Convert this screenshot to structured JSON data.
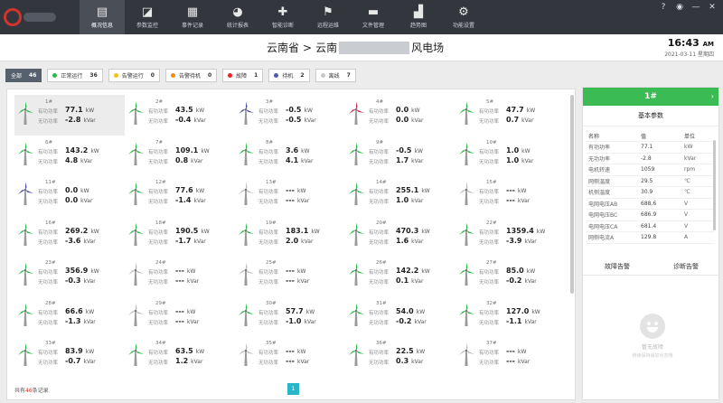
{
  "app": {
    "logo_icon": "company-logo-icon"
  },
  "nav": [
    {
      "label": "概况信息",
      "icon": "overview-icon",
      "glyph": "▤",
      "active": true
    },
    {
      "label": "参数监控",
      "icon": "monitor-icon",
      "glyph": "◪",
      "active": false
    },
    {
      "label": "事件记录",
      "icon": "event-log-icon",
      "glyph": "▦",
      "active": false
    },
    {
      "label": "统计报表",
      "icon": "pie-chart-icon",
      "glyph": "◕",
      "active": false
    },
    {
      "label": "智能诊断",
      "icon": "medical-kit-icon",
      "glyph": "✚",
      "active": false
    },
    {
      "label": "远程运维",
      "icon": "remote-maintenance-icon",
      "glyph": "⚑",
      "active": false
    },
    {
      "label": "文件管理",
      "icon": "folder-icon",
      "glyph": "▬",
      "active": false
    },
    {
      "label": "趋势图",
      "icon": "trend-chart-icon",
      "glyph": "▟",
      "active": false
    },
    {
      "label": "功能设置",
      "icon": "settings-icon",
      "glyph": "⚙",
      "active": false
    }
  ],
  "window_buttons": [
    {
      "glyph": "?",
      "icon": "help-icon"
    },
    {
      "glyph": "◉",
      "icon": "user-icon"
    },
    {
      "glyph": "—",
      "icon": "minimize-icon"
    },
    {
      "glyph": "✕",
      "icon": "close-icon"
    }
  ],
  "header": {
    "province": "云南省",
    "separator": ">",
    "prefix": "云南",
    "suffix": "风电场",
    "time": "16:43",
    "ampm": "AM",
    "date": "2021-03-11",
    "weekday": "星期四"
  },
  "filters": [
    {
      "label": "全部",
      "count": "46",
      "color": "",
      "active": true
    },
    {
      "label": "正常运行",
      "count": "36",
      "color": "#2fb84a",
      "active": false
    },
    {
      "label": "告警运行",
      "count": "0",
      "color": "#f2c21b",
      "active": false
    },
    {
      "label": "告警待机",
      "count": "0",
      "color": "#f28c1b",
      "active": false
    },
    {
      "label": "故障",
      "count": "1",
      "color": "#e5262b",
      "active": false
    },
    {
      "label": "待机",
      "count": "2",
      "color": "#4a58b8",
      "active": false
    },
    {
      "label": "离线",
      "count": "7",
      "color": "#c8c8c8",
      "active": false
    }
  ],
  "labels": {
    "active_power": "有功功率",
    "reactive_power": "无功功率",
    "kw": "kW",
    "kvar": "kVar"
  },
  "colors": {
    "normal": "#2fb84a",
    "fault": "#d22a4a",
    "standby": "#4a4ea8",
    "offline": "#bdbdbd"
  },
  "turbines": [
    {
      "id": "1#",
      "status": "normal",
      "p": "77.1",
      "q": "-2.8",
      "selected": true
    },
    {
      "id": "2#",
      "status": "normal",
      "p": "43.5",
      "q": "-0.4"
    },
    {
      "id": "3#",
      "status": "standby",
      "p": "-0.5",
      "q": "-0.5"
    },
    {
      "id": "4#",
      "status": "fault",
      "p": "0.0",
      "q": "0.0"
    },
    {
      "id": "5#",
      "status": "normal",
      "p": "47.7",
      "q": "0.7"
    },
    {
      "id": "6#",
      "status": "normal",
      "p": "143.2",
      "q": "4.8"
    },
    {
      "id": "7#",
      "status": "normal",
      "p": "109.1",
      "q": "0.8"
    },
    {
      "id": "8#",
      "status": "normal",
      "p": "3.6",
      "q": "4.1"
    },
    {
      "id": "9#",
      "status": "normal",
      "p": "-0.5",
      "q": "1.7"
    },
    {
      "id": "10#",
      "status": "normal",
      "p": "1.0",
      "q": "1.0"
    },
    {
      "id": "11#",
      "status": "standby",
      "p": "0.0",
      "q": "0.0"
    },
    {
      "id": "12#",
      "status": "normal",
      "p": "77.6",
      "q": "-1.4"
    },
    {
      "id": "13#",
      "status": "offline",
      "p": "---",
      "q": "---"
    },
    {
      "id": "14#",
      "status": "normal",
      "p": "255.1",
      "q": "1.0"
    },
    {
      "id": "15#",
      "status": "offline",
      "p": "---",
      "q": "---"
    },
    {
      "id": "16#",
      "status": "normal",
      "p": "269.2",
      "q": "-3.6"
    },
    {
      "id": "18#",
      "status": "normal",
      "p": "190.5",
      "q": "-1.7"
    },
    {
      "id": "19#",
      "status": "normal",
      "p": "183.1",
      "q": "2.0"
    },
    {
      "id": "20#",
      "status": "normal",
      "p": "470.3",
      "q": "1.6"
    },
    {
      "id": "22#",
      "status": "normal",
      "p": "1359.4",
      "q": "-3.9"
    },
    {
      "id": "23#",
      "status": "normal",
      "p": "356.9",
      "q": "-0.3"
    },
    {
      "id": "24#",
      "status": "offline",
      "p": "---",
      "q": "---"
    },
    {
      "id": "25#",
      "status": "offline",
      "p": "---",
      "q": "---"
    },
    {
      "id": "26#",
      "status": "normal",
      "p": "142.2",
      "q": "0.1"
    },
    {
      "id": "27#",
      "status": "normal",
      "p": "85.0",
      "q": "-0.2"
    },
    {
      "id": "28#",
      "status": "normal",
      "p": "66.6",
      "q": "-1.3"
    },
    {
      "id": "29#",
      "status": "offline",
      "p": "---",
      "q": "---"
    },
    {
      "id": "30#",
      "status": "normal",
      "p": "57.7",
      "q": "-1.0"
    },
    {
      "id": "31#",
      "status": "normal",
      "p": "54.0",
      "q": "-0.2"
    },
    {
      "id": "32#",
      "status": "normal",
      "p": "127.0",
      "q": "-1.1"
    },
    {
      "id": "33#",
      "status": "normal",
      "p": "83.9",
      "q": "-0.7"
    },
    {
      "id": "34#",
      "status": "normal",
      "p": "63.5",
      "q": "1.2"
    },
    {
      "id": "35#",
      "status": "offline",
      "p": "---",
      "q": "---"
    },
    {
      "id": "36#",
      "status": "normal",
      "p": "22.5",
      "q": "0.3"
    },
    {
      "id": "37#",
      "status": "offline",
      "p": "---",
      "q": "---"
    }
  ],
  "footer": {
    "prefix": "共有",
    "count": "46",
    "suffix": "条记录",
    "page": "1"
  },
  "detail": {
    "title": "1#",
    "subtitle": "基本参数",
    "headers": [
      "名称",
      "值",
      "单位"
    ],
    "params": [
      [
        "有功功率",
        "77.1",
        "kW"
      ],
      [
        "无功功率",
        "-2.8",
        "kVar"
      ],
      [
        "电机转速",
        "1059",
        "rpm"
      ],
      [
        "网侧温度",
        "29.5",
        "℃"
      ],
      [
        "机侧温度",
        "30.9",
        "℃"
      ],
      [
        "电网电压AB",
        "688.6",
        "V"
      ],
      [
        "电网电压BC",
        "686.9",
        "V"
      ],
      [
        "电网电压CA",
        "681.4",
        "V"
      ],
      [
        "网侧电流A",
        "129.8",
        "A"
      ]
    ],
    "tab_fault": "故障告警",
    "tab_diag": "诊断告警",
    "empty_title": "暂无故障",
    "empty_sub": "继续保持良好状态哦"
  }
}
